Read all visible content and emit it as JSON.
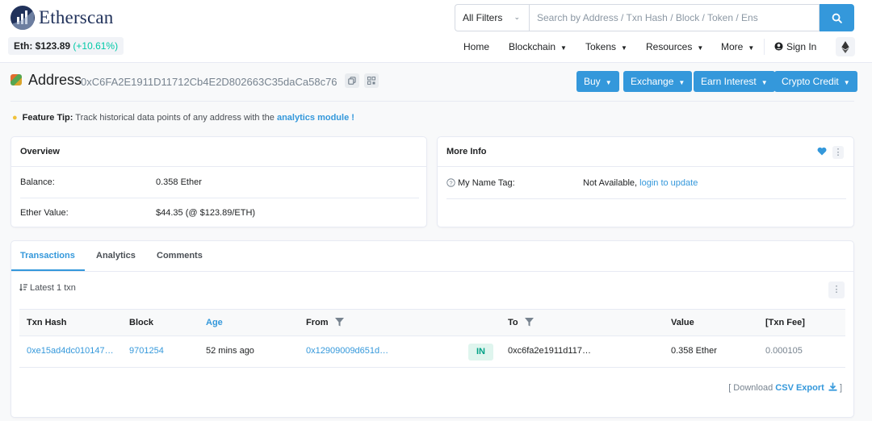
{
  "brand": {
    "name": "Etherscan"
  },
  "price": {
    "label": "Eth: $123.89",
    "change": "(+10.61%)"
  },
  "search": {
    "filter": "All Filters",
    "placeholder": "Search by Address / Txn Hash / Block / Token / Ens"
  },
  "nav": {
    "home": "Home",
    "blockchain": "Blockchain",
    "tokens": "Tokens",
    "resources": "Resources",
    "more": "More",
    "signin": "Sign In"
  },
  "address": {
    "label": "Address",
    "hash": "0xC6FA2E1911D11712Cb4E2D802663C35daCa58c76"
  },
  "actions": {
    "buy": "Buy",
    "exchange": "Exchange",
    "earn": "Earn Interest",
    "credit": "Crypto Credit"
  },
  "tip": {
    "prefix": "Feature Tip:",
    "text": "Track historical data points of any address with the",
    "link": "analytics module !"
  },
  "overview": {
    "title": "Overview",
    "balance_label": "Balance:",
    "balance_value": "0.358 Ether",
    "value_label": "Ether Value:",
    "value_value": "$44.35 (@ $123.89/ETH)"
  },
  "more_info": {
    "title": "More Info",
    "tag_label": "My Name Tag:",
    "tag_value": "Not Available,",
    "tag_link": "login to update"
  },
  "tabs": [
    "Transactions",
    "Analytics",
    "Comments"
  ],
  "txns": {
    "latest": "Latest 1 txn",
    "columns": [
      "Txn Hash",
      "Block",
      "Age",
      "From",
      "To",
      "Value",
      "[Txn Fee]"
    ],
    "rows": [
      {
        "hash": "0xe15ad4dc010147…",
        "block": "9701254",
        "age": "52 mins ago",
        "from": "0x12909009d651d…",
        "direction": "IN",
        "to": "0xc6fa2e1911d117…",
        "value": "0.358 Ether",
        "fee": "0.000105"
      }
    ],
    "download_prefix": "[ Download",
    "download_link": "CSV Export",
    "download_suffix": "]"
  },
  "colors": {
    "accent": "#3498db",
    "brand": "#21325b",
    "positive": "#00c9a7"
  }
}
